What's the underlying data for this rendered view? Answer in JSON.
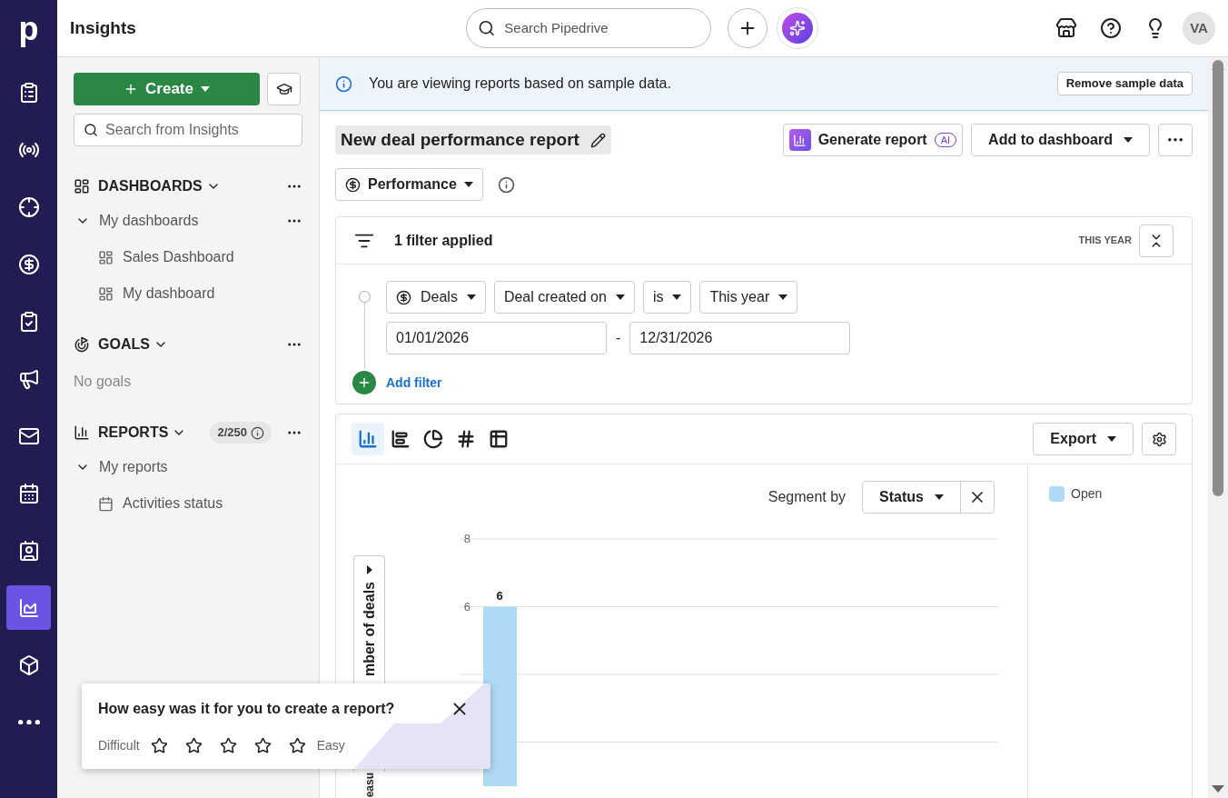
{
  "nav": {
    "logo": "p",
    "items": [
      {
        "selected": false
      },
      {
        "selected": false
      },
      {
        "selected": false
      },
      {
        "selected": false
      },
      {
        "selected": false
      },
      {
        "selected": false
      },
      {
        "selected": false
      },
      {
        "selected": false
      },
      {
        "selected": false
      },
      {
        "selected": true
      },
      {
        "selected": false
      },
      {
        "selected": false
      }
    ]
  },
  "topbar": {
    "title": "Insights",
    "search": {
      "placeholder": "Search Pipedrive"
    },
    "avatar": "VA"
  },
  "sidebar": {
    "create": "Create",
    "search": {
      "placeholder": "Search from Insights"
    },
    "sections": [
      {
        "kind": "dashboards",
        "title": "DASHBOARDS",
        "expanded": true,
        "groups": [
          {
            "label": "My dashboards",
            "expanded": true,
            "children": [
              {
                "label": "Sales Dashboard"
              },
              {
                "label": "My dashboard"
              }
            ]
          }
        ]
      },
      {
        "kind": "goals",
        "title": "GOALS",
        "expanded": true,
        "empty": "No goals"
      },
      {
        "kind": "reports",
        "title": "REPORTS",
        "expanded": true,
        "badge": "2/250",
        "groups": [
          {
            "label": "My reports",
            "expanded": true,
            "children": [
              {
                "label": "Activities status"
              }
            ]
          }
        ]
      }
    ]
  },
  "banner": {
    "text": "You are viewing reports based on sample data.",
    "button": "Remove sample data"
  },
  "report": {
    "title": "New deal performance report",
    "generate": "Generate report",
    "ai_badge": "AI",
    "add_to_dashboard": "Add to dashboard",
    "type": "Performance"
  },
  "filters": {
    "summary": "1 filter applied",
    "period": "THIS YEAR",
    "expanded": true,
    "conditions": [
      {
        "entity": "Deals",
        "field": "Deal created on",
        "operator": "is",
        "value": "This year",
        "from": "01/01/2026",
        "separator": "-",
        "to": "12/31/2026"
      }
    ],
    "add": "Add filter"
  },
  "chart_panel": {
    "views": [
      {
        "selected": true
      },
      {
        "selected": false
      },
      {
        "selected": false
      },
      {
        "selected": false
      },
      {
        "selected": false
      }
    ],
    "export": "Export",
    "segment_label": "Segment by",
    "segment_value": "Status",
    "axis_toggle": "mber of deals",
    "axis_tail": "easu",
    "chart_data": {
      "type": "bar",
      "series": [
        {
          "name": "Open",
          "color": "#afdaf5",
          "values": [
            6
          ]
        }
      ],
      "ylim": [
        0,
        8
      ],
      "yticks": [
        8,
        6
      ],
      "data_labels": true
    }
  },
  "feedback": {
    "question": "How easy was it for you to create a report?",
    "low": "Difficult",
    "high": "Easy",
    "stars": 0
  }
}
